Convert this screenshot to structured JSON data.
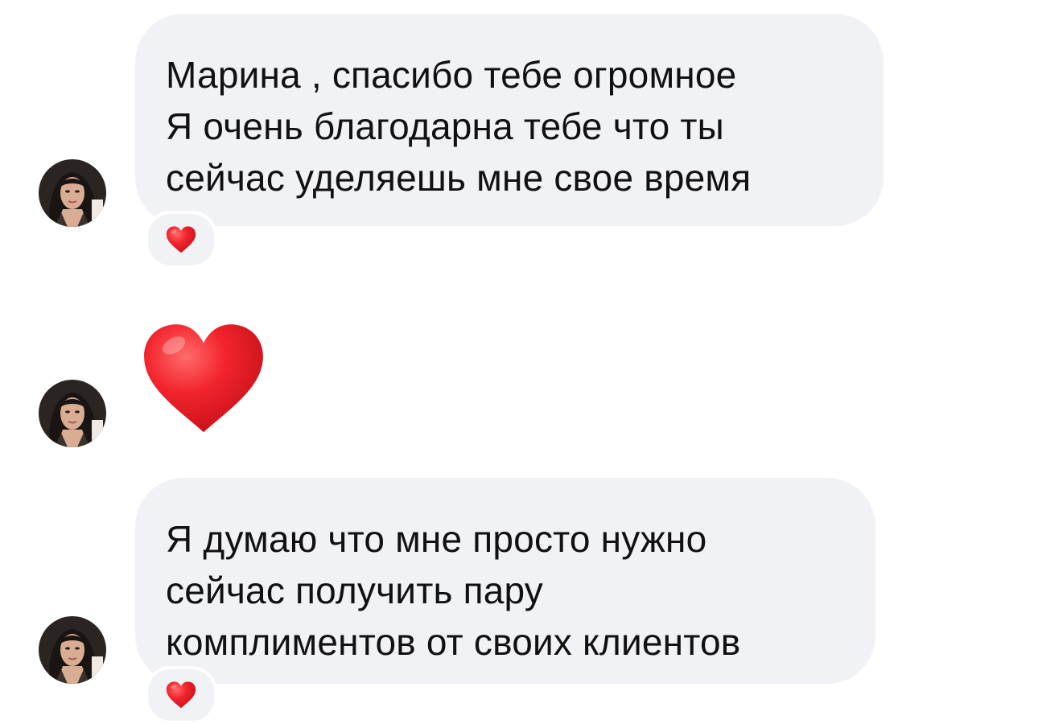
{
  "messages": [
    {
      "type": "text",
      "lines": [
        "Марина , спасибо тебе огромное",
        "Я очень благодарна тебе что ты",
        "сейчас уделяешь мне свое время"
      ],
      "reaction": "red-heart-icon"
    },
    {
      "type": "emoji",
      "emoji": "red-heart-icon"
    },
    {
      "type": "text",
      "lines": [
        "Я думаю что мне просто нужно",
        "сейчас получить пару",
        "комплиментов от своих клиентов"
      ],
      "reaction": "red-heart-icon"
    }
  ],
  "colors": {
    "bubble": "#f1f2f6",
    "text": "#111111",
    "heart": "#e8202a"
  }
}
